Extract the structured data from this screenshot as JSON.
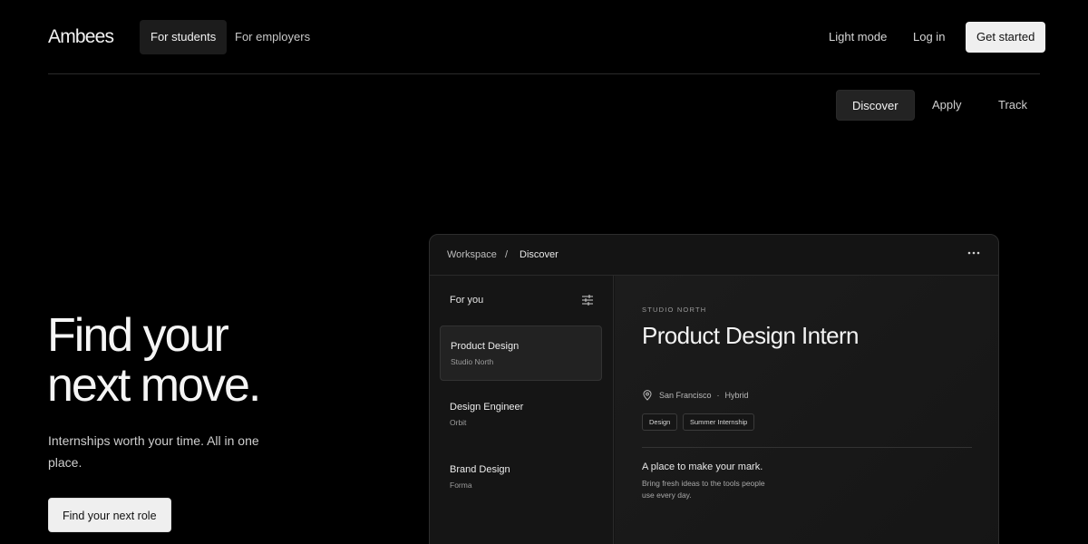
{
  "brand": {
    "name": "Ambees"
  },
  "nav": {
    "audience_tabs": [
      {
        "label": "For students",
        "active": true
      },
      {
        "label": "For employers",
        "active": false
      }
    ],
    "light_mode_label": "Light mode",
    "login_label": "Log in",
    "get_started_label": "Get started"
  },
  "subtabs": [
    {
      "label": "Discover",
      "active": true
    },
    {
      "label": "Apply",
      "active": false
    },
    {
      "label": "Track",
      "active": false
    }
  ],
  "hero": {
    "title_line1": "Find your",
    "title_line2": "next move.",
    "subtitle": "Internships worth your time. All in one place.",
    "cta_label": "Find your next role"
  },
  "workspace": {
    "breadcrumb": {
      "root": "Workspace",
      "separator": "/",
      "current": "Discover"
    },
    "more_icon": "more-horizontal-icon",
    "sidebar": {
      "heading": "For you",
      "filter_icon": "sliders-icon",
      "items": [
        {
          "title": "Product Design",
          "company": "Studio North",
          "active": true
        },
        {
          "title": "Design Engineer",
          "company": "Orbit",
          "active": false
        },
        {
          "title": "Brand Design",
          "company": "Forma",
          "active": false
        }
      ]
    },
    "detail": {
      "company": "STUDIO NORTH",
      "title": "Product Design Intern",
      "location": "San Francisco",
      "separator": "·",
      "work_mode": "Hybrid",
      "tags": [
        "Design",
        "Summer Internship"
      ],
      "pitch_title": "A place to make your mark.",
      "pitch_body": "Bring fresh ideas to the tools people use every day."
    }
  },
  "colors": {
    "background": "#000000",
    "card": "#141414",
    "button_light": "#efefef",
    "active_pill": "#1c1c1c"
  }
}
